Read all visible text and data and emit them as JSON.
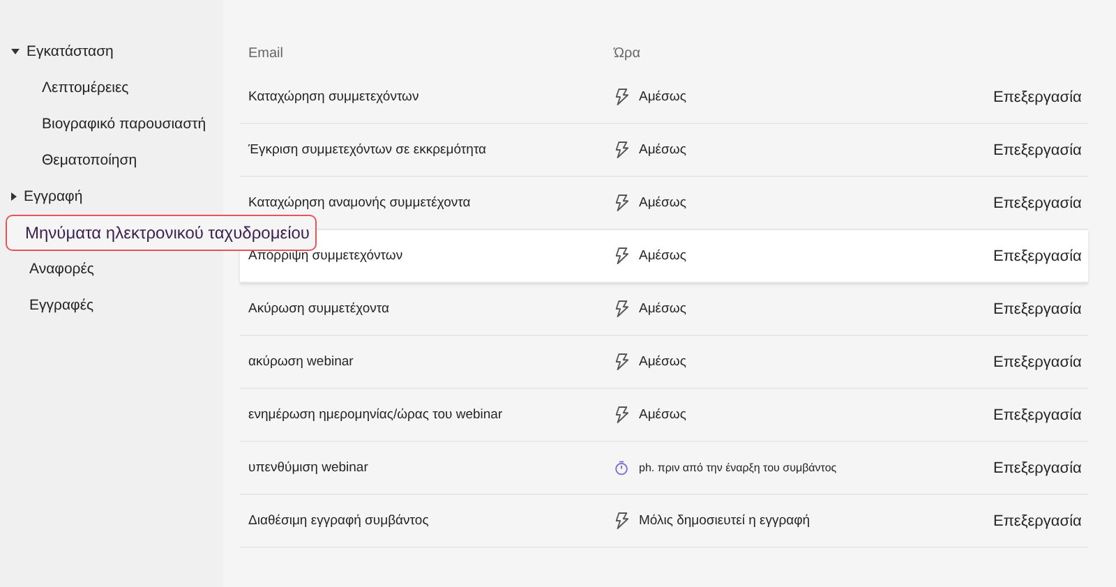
{
  "sidebar": {
    "items": [
      {
        "label": "Εγκατάσταση",
        "selected": false,
        "expanded": true,
        "children": [
          {
            "label": "Λεπτομέρειες",
            "selected": false
          },
          {
            "label": "Βιογραφικό παρουσιαστή",
            "selected": false
          },
          {
            "label": "Θεματοποίηση",
            "selected": false
          }
        ]
      },
      {
        "label": "Εγγραφή",
        "selected": false,
        "expanded": false
      },
      {
        "label": "Μηνύματα ηλεκτρονικού ταχυδρομείου",
        "selected": true
      },
      {
        "label": "Αναφορές",
        "selected": false
      },
      {
        "label": "Εγγραφές",
        "selected": false
      }
    ]
  },
  "table": {
    "columns": [
      "Email",
      "Ώρα"
    ],
    "rows": [
      {
        "email": "Καταχώρηση συμμετεχόντων",
        "kind": "instant",
        "time": "Αμέσως",
        "action": "Επεξεργασία",
        "highlighted": false
      },
      {
        "email": "Έγκριση συμμετεχόντων σε εκκρεμότητα",
        "kind": "instant",
        "time": "Αμέσως",
        "action": "Επεξεργασία",
        "highlighted": false
      },
      {
        "email": "Καταχώρηση αναμονής συμμετέχοντα",
        "kind": "instant",
        "time": "Αμέσως",
        "action": "Επεξεργασία",
        "highlighted": false
      },
      {
        "email": "Απόρριψη συμμετεχόντων",
        "kind": "instant",
        "time": "Αμέσως",
        "action": "Επεξεργασία",
        "highlighted": true
      },
      {
        "email": "Ακύρωση συμμετέχοντα",
        "kind": "instant",
        "time": "Αμέσως",
        "action": "Επεξεργασία",
        "highlighted": false
      },
      {
        "email": "ακύρωση webinar",
        "kind": "instant",
        "time": "Αμέσως",
        "action": "Επεξεργασία",
        "highlighted": false
      },
      {
        "email": "ενημέρωση ημερομηνίας/ώρας του webinar",
        "kind": "instant",
        "time": "Αμέσως",
        "action": "Επεξεργασία",
        "highlighted": false
      },
      {
        "email": "υπενθύμιση webinar",
        "kind": "timer",
        "time": "ph. πριν από την έναρξη του συμβάντος",
        "action": "Επεξεργασία",
        "highlighted": false
      },
      {
        "email": "Διαθέσιμη εγγραφή συμβάντος",
        "kind": "instant",
        "time": "Μόλις δημοσιευτεί η εγγραφή",
        "action": "Επεξεργασία",
        "highlighted": false
      }
    ]
  }
}
